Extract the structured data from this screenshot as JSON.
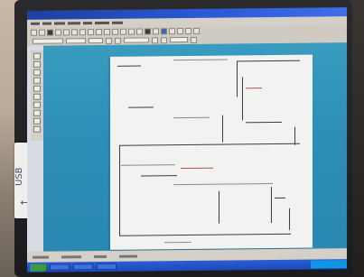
{
  "sticker": {
    "text": "USB",
    "arrow": "←"
  },
  "icons": {
    "usb": "usb-arrow-icon",
    "start": "start-icon"
  },
  "colors": {
    "titlebar": "#2d5bd8",
    "workspace": "#2f8fb8",
    "sheet": "#f2f2f0",
    "taskbar": "#1c49b8"
  }
}
